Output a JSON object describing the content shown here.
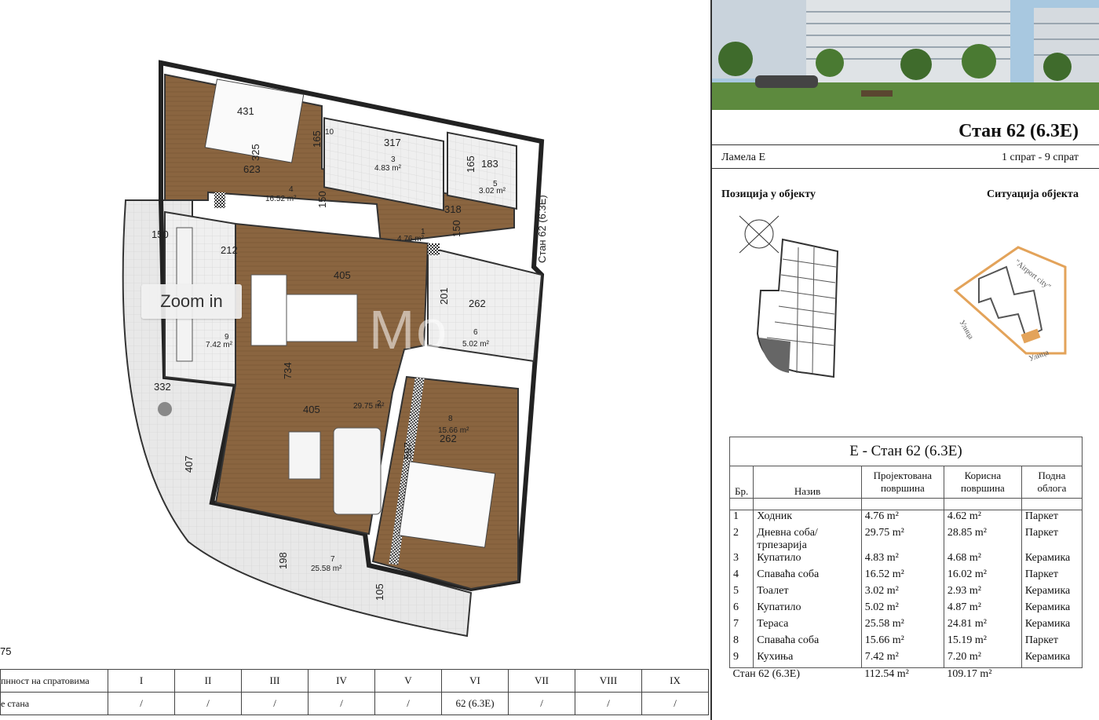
{
  "plan": {
    "zoom_label": "Zoom in",
    "scale_text": "75",
    "dims": [
      "431",
      "325",
      "623",
      "317",
      "165",
      "183",
      "10",
      "165",
      "150",
      "318",
      "150",
      "4.76 m²",
      "405",
      "212",
      "150",
      "201",
      "262",
      "734",
      "405",
      "29.75 m²",
      "15.66 m²",
      "262",
      "597",
      "332",
      "407",
      "198",
      "105",
      "25.58 m²",
      "16.52 m²",
      "4.83 m²",
      "3.02 m²",
      "5.02 m²",
      "7.42 m²"
    ],
    "room_nums": [
      "4",
      "3",
      "5",
      "1",
      "6",
      "9",
      "2",
      "8",
      "7"
    ],
    "side_label": "Стан 62 (6.3Е)",
    "watermark": "Mo"
  },
  "floors": {
    "row1_label": "пнност на спратовима",
    "row2_label": "е стана",
    "numerals": [
      "I",
      "II",
      "III",
      "IV",
      "V",
      "VI",
      "VII",
      "VIII",
      "IX"
    ],
    "row2_values": [
      "/",
      "/",
      "/",
      "/",
      "/",
      "62 (6.3Е)",
      "/",
      "/",
      "/"
    ]
  },
  "header": {
    "title": "Стан 62 (6.3Е)",
    "lamela": "Ламела Е",
    "floors": "1 спрат - 9 спрат",
    "position_heading": "Позиција у објекту",
    "situation_heading": "Ситуација објекта",
    "airport_label": "\"Аirport city\"",
    "street1": "Улица",
    "street2": "Улица"
  },
  "spec": {
    "caption": "Е - Стан 62 (6.3Е)",
    "headers": [
      "Бр.",
      "Назив",
      "Пројектована површина",
      "Корисна површина",
      "Подна облога"
    ],
    "rows": [
      {
        "no": "1",
        "name": "Ходник",
        "proj": "4.76 m²",
        "use": "4.62 m²",
        "floor": "Паркет"
      },
      {
        "no": "2",
        "name": "Дневна соба/трпезарија",
        "proj": "29.75 m²",
        "use": "28.85 m²",
        "floor": "Паркет"
      },
      {
        "no": "3",
        "name": "Купатило",
        "proj": "4.83 m²",
        "use": "4.68 m²",
        "floor": "Керамика"
      },
      {
        "no": "4",
        "name": "Спаваћа соба",
        "proj": "16.52 m²",
        "use": "16.02 m²",
        "floor": "Паркет"
      },
      {
        "no": "5",
        "name": "Тоалет",
        "proj": "3.02 m²",
        "use": "2.93 m²",
        "floor": "Керамика"
      },
      {
        "no": "6",
        "name": "Купатило",
        "proj": "5.02 m²",
        "use": "4.87 m²",
        "floor": "Керамика"
      },
      {
        "no": "7",
        "name": "Тераса",
        "proj": "25.58 m²",
        "use": "24.81 m²",
        "floor": "Керамика"
      },
      {
        "no": "8",
        "name": "Спаваћа соба",
        "proj": "15.66 m²",
        "use": "15.19 m²",
        "floor": "Паркет"
      },
      {
        "no": "9",
        "name": "Кухиња",
        "proj": "7.42 m²",
        "use": "7.20 m²",
        "floor": "Керамика"
      }
    ],
    "total_label": "Стан 62 (6.3Е)",
    "total_proj": "112.54 m²",
    "total_use": "109.17 m²"
  }
}
